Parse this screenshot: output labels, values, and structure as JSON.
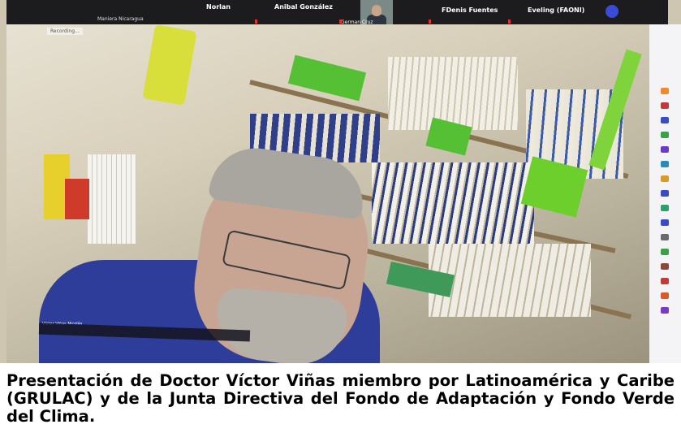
{
  "zoom_strip": {
    "participants": [
      "Maniera Nicaragua",
      "Norlan",
      "Anibal González",
      "German Cruz",
      "FDenis Fuentes",
      "Eveling (FAONI)"
    ]
  },
  "overlay": {
    "recording_label": "Recording...",
    "speaker_tag": "Víctor Viñas Nicolás"
  },
  "caption": {
    "text": "Presentación de Doctor Víctor Viñas miembro por Latinoamérica y Caribe (GRULAC) y de la Junta Directiva del Fondo de Adaptación y Fondo Verde del Clima."
  }
}
